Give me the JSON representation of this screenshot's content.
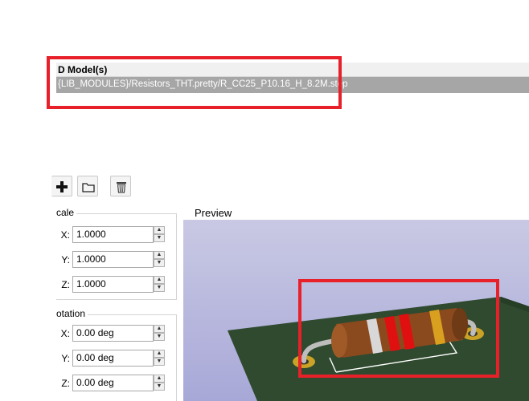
{
  "models": {
    "header": "D Model(s)",
    "rows": [
      "{LIB_MODULES}/Resistors_THT.pretty/R_CC25_P10.16_H_8.2M.step"
    ]
  },
  "toolbar": {
    "add_icon": "plus-icon",
    "browse_icon": "folder-icon",
    "remove_icon": "trash-icon"
  },
  "scale": {
    "title": "cale",
    "x_label": "X:",
    "x_value": "1.0000",
    "y_label": "Y:",
    "y_value": "1.0000",
    "z_label": "Z:",
    "z_value": "1.0000"
  },
  "rotation": {
    "title": "otation",
    "x_label": "X:",
    "x_value": "0.00 deg",
    "y_label": "Y:",
    "y_value": "0.00 deg",
    "z_label": "Z:",
    "z_value": "0.00 deg"
  },
  "preview": {
    "label": "Preview"
  },
  "colors": {
    "highlight": "#e8202a",
    "selected_row": "#a6a6a6",
    "pcb_green": "#2f4a2f",
    "resistor_body": "#8b4a1e"
  }
}
